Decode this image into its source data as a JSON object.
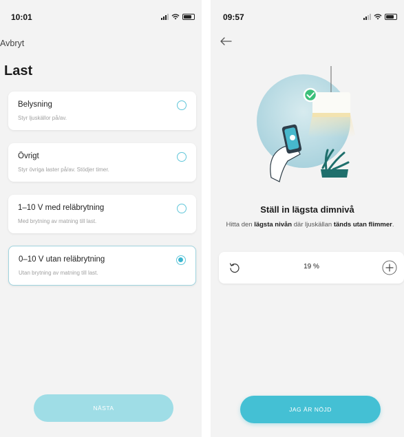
{
  "left_screen": {
    "status_time": "10:01",
    "cancel_label": "Avbryt",
    "title": "Last",
    "options": [
      {
        "title": "Belysning",
        "subtitle": "Styr ljuskällor på/av.",
        "selected": false
      },
      {
        "title": "Övrigt",
        "subtitle": "Styr övriga laster på/av. Stödjer timer.",
        "selected": false
      },
      {
        "title": "1–10 V med reläbrytning",
        "subtitle": "Med brytning av matning till last.",
        "selected": false
      },
      {
        "title": "0–10 V utan reläbrytning",
        "subtitle": "Utan brytning av matning till last.",
        "selected": true
      }
    ],
    "next_label": "NÄSTA"
  },
  "right_screen": {
    "status_time": "09:57",
    "heading": "Ställ in lägsta dimnivå",
    "description": {
      "part1": "Hitta den ",
      "bold1": "lägsta nivån",
      "part2": " där ljuskällan ",
      "bold2": "tänds utan flimmer",
      "part3": "."
    },
    "stepper_value": "19 %",
    "done_label": "JAG ÄR NÖJD"
  },
  "colors": {
    "accent": "#44c0d4",
    "accent_light": "#9fdde6",
    "check_green": "#3cc07a"
  },
  "icons": [
    "back-arrow-icon",
    "reset-icon",
    "plus-icon",
    "check-icon",
    "signal-icon",
    "wifi-icon",
    "battery-icon"
  ]
}
